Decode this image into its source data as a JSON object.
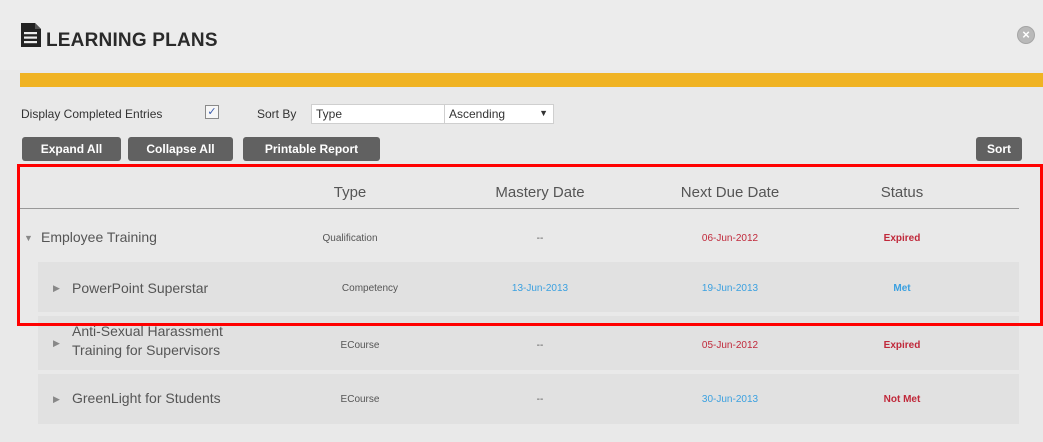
{
  "header": {
    "title": "LEARNING PLANS",
    "close_glyph": "×"
  },
  "controls": {
    "display_completed_label": "Display Completed Entries",
    "display_completed_checked": true,
    "sort_by_label": "Sort By",
    "sort_by_value": "Type",
    "order_value": "Ascending"
  },
  "buttons": {
    "expand_all": "Expand All",
    "collapse_all": "Collapse All",
    "printable_report": "Printable Report",
    "sort": "Sort"
  },
  "table": {
    "columns": [
      "Type",
      "Mastery Date",
      "Next Due Date",
      "Status"
    ],
    "rows": [
      {
        "name": "Employee Training",
        "type": "Qualification",
        "mastery": "--",
        "due": "06-Jun-2012",
        "status": "Expired",
        "expanded": true
      },
      {
        "name": "PowerPoint Superstar",
        "type": "Competency",
        "mastery": "13-Jun-2013",
        "due": "19-Jun-2013",
        "status": "Met"
      },
      {
        "name_line1": "Anti-Sexual Harassment",
        "name_line2": "Training for Supervisors",
        "type": "ECourse",
        "mastery": "--",
        "due": "05-Jun-2012",
        "status": "Expired"
      },
      {
        "name": "GreenLight for Students",
        "type": "ECourse",
        "mastery": "--",
        "due": "30-Jun-2013",
        "status": "Not Met"
      }
    ]
  },
  "colors": {
    "accent": "#f0b323",
    "expired": "#c0283a",
    "met": "#3aa0e0",
    "highlight": "#ff0000"
  },
  "icons": {
    "header": "document-icon",
    "close": "close-icon",
    "expand": "triangle-right-icon",
    "collapse": "triangle-down-icon"
  }
}
